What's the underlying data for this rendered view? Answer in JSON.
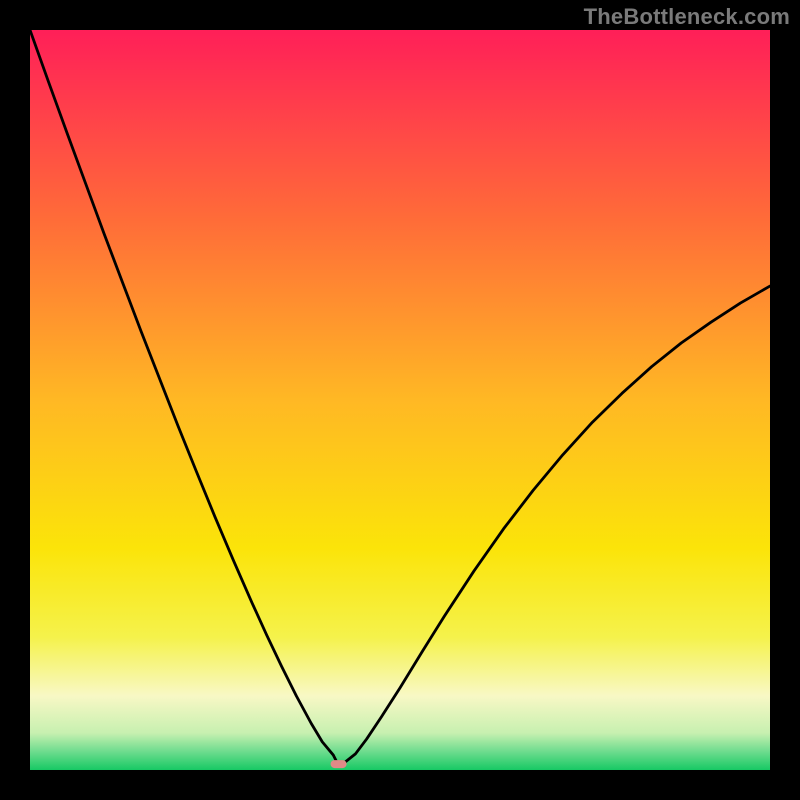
{
  "watermark": "TheBottleneck.com",
  "chart_data": {
    "type": "line",
    "title": "",
    "xlabel": "",
    "ylabel": "",
    "xlim": [
      0,
      1
    ],
    "ylim": [
      0,
      1
    ],
    "series": [
      {
        "name": "curve",
        "x": [
          0.0,
          0.025,
          0.05,
          0.075,
          0.1,
          0.125,
          0.15,
          0.175,
          0.2,
          0.225,
          0.25,
          0.275,
          0.3,
          0.32,
          0.34,
          0.36,
          0.38,
          0.395,
          0.41,
          0.415,
          0.425,
          0.44,
          0.455,
          0.475,
          0.5,
          0.53,
          0.56,
          0.6,
          0.64,
          0.68,
          0.72,
          0.76,
          0.8,
          0.84,
          0.88,
          0.92,
          0.96,
          1.0
        ],
        "y": [
          1.0,
          0.93,
          0.861,
          0.793,
          0.725,
          0.659,
          0.593,
          0.529,
          0.465,
          0.403,
          0.342,
          0.283,
          0.226,
          0.182,
          0.14,
          0.1,
          0.063,
          0.038,
          0.02,
          0.01,
          0.01,
          0.022,
          0.042,
          0.072,
          0.111,
          0.16,
          0.208,
          0.269,
          0.326,
          0.378,
          0.426,
          0.47,
          0.509,
          0.545,
          0.577,
          0.605,
          0.631,
          0.654
        ]
      }
    ],
    "marker": {
      "x": 0.417,
      "y": 0.008
    },
    "gradient_stops": [
      {
        "offset": 0.0,
        "color": "#ff1f58"
      },
      {
        "offset": 0.25,
        "color": "#ff6a39"
      },
      {
        "offset": 0.5,
        "color": "#ffb824"
      },
      {
        "offset": 0.7,
        "color": "#fbe409"
      },
      {
        "offset": 0.82,
        "color": "#f5f24b"
      },
      {
        "offset": 0.9,
        "color": "#f8f8c5"
      },
      {
        "offset": 0.95,
        "color": "#c7f0b0"
      },
      {
        "offset": 0.975,
        "color": "#6edc8e"
      },
      {
        "offset": 1.0,
        "color": "#17c964"
      }
    ],
    "marker_color": "#e08a87",
    "curve_color": "#000000",
    "curve_width": 2.8
  }
}
